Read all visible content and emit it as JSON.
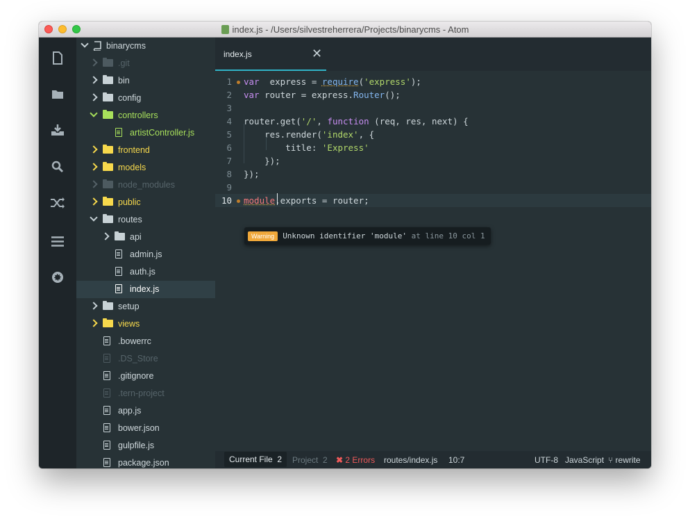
{
  "window": {
    "title": "index.js - /Users/silvestreherrera/Projects/binarycms - Atom"
  },
  "sidebar_icons": [
    "file-icon",
    "folder-icon",
    "download-icon",
    "search-icon",
    "shuffle-icon",
    "menu-icon",
    "gear-icon"
  ],
  "tree": {
    "root": "binarycms",
    "items": [
      {
        "label": ".git",
        "type": "folder",
        "depth": 1,
        "state": "collapsed",
        "style": "dim"
      },
      {
        "label": "bin",
        "type": "folder",
        "depth": 1,
        "state": "collapsed",
        "style": "normal"
      },
      {
        "label": "config",
        "type": "folder",
        "depth": 1,
        "state": "collapsed",
        "style": "normal"
      },
      {
        "label": "controllers",
        "type": "folder",
        "depth": 1,
        "state": "expanded",
        "style": "green"
      },
      {
        "label": "artistController.js",
        "type": "file",
        "depth": 2,
        "style": "green"
      },
      {
        "label": "frontend",
        "type": "folder",
        "depth": 1,
        "state": "collapsed",
        "style": "yellow"
      },
      {
        "label": "models",
        "type": "folder",
        "depth": 1,
        "state": "collapsed",
        "style": "yellow"
      },
      {
        "label": "node_modules",
        "type": "folder",
        "depth": 1,
        "state": "collapsed",
        "style": "dim"
      },
      {
        "label": "public",
        "type": "folder",
        "depth": 1,
        "state": "collapsed",
        "style": "yellow"
      },
      {
        "label": "routes",
        "type": "folder",
        "depth": 1,
        "state": "expanded",
        "style": "normal"
      },
      {
        "label": "api",
        "type": "folder",
        "depth": 2,
        "state": "collapsed",
        "style": "normal"
      },
      {
        "label": "admin.js",
        "type": "file",
        "depth": 2,
        "style": "normal"
      },
      {
        "label": "auth.js",
        "type": "file",
        "depth": 2,
        "style": "normal"
      },
      {
        "label": "index.js",
        "type": "file",
        "depth": 2,
        "style": "selected"
      },
      {
        "label": "setup",
        "type": "folder",
        "depth": 1,
        "state": "collapsed",
        "style": "normal"
      },
      {
        "label": "views",
        "type": "folder",
        "depth": 1,
        "state": "collapsed",
        "style": "yellow"
      },
      {
        "label": ".bowerrc",
        "type": "file",
        "depth": 1,
        "style": "normal"
      },
      {
        "label": ".DS_Store",
        "type": "file",
        "depth": 1,
        "style": "dim"
      },
      {
        "label": ".gitignore",
        "type": "file",
        "depth": 1,
        "style": "normal"
      },
      {
        "label": ".tern-project",
        "type": "file",
        "depth": 1,
        "style": "dim"
      },
      {
        "label": "app.js",
        "type": "file",
        "depth": 1,
        "style": "normal"
      },
      {
        "label": "bower.json",
        "type": "file",
        "depth": 1,
        "style": "normal"
      },
      {
        "label": "gulpfile.js",
        "type": "file",
        "depth": 1,
        "style": "normal"
      },
      {
        "label": "package.json",
        "type": "file",
        "depth": 1,
        "style": "normal"
      }
    ]
  },
  "tab": {
    "label": "index.js",
    "close": "✕"
  },
  "editor": {
    "lines": [
      {
        "n": "1",
        "tokens": [
          [
            "kw",
            "var"
          ],
          [
            "",
            "  express = "
          ],
          [
            "fn warnline",
            "require"
          ],
          [
            "",
            "("
          ],
          [
            "str",
            "'express'"
          ],
          [
            "",
            ");"
          ]
        ],
        "marker": true
      },
      {
        "n": "2",
        "tokens": [
          [
            "kw",
            "var"
          ],
          [
            "",
            " router = express."
          ],
          [
            "fn",
            "Router"
          ],
          [
            "",
            "();"
          ]
        ]
      },
      {
        "n": "3",
        "tokens": []
      },
      {
        "n": "4",
        "tokens": [
          [
            "",
            "router.get("
          ],
          [
            "str",
            "'/'"
          ],
          [
            "",
            ", "
          ],
          [
            "kw",
            "function"
          ],
          [
            "",
            " (req, res, next) {"
          ]
        ]
      },
      {
        "n": "5",
        "tokens": [
          [
            "",
            "    res.render("
          ],
          [
            "str",
            "'index'"
          ],
          [
            "",
            ", {"
          ]
        ]
      },
      {
        "n": "6",
        "tokens": [
          [
            "",
            "        title: "
          ],
          [
            "str",
            "'Express'"
          ]
        ]
      },
      {
        "n": "7",
        "tokens": [
          [
            "",
            "    });"
          ]
        ]
      },
      {
        "n": "8",
        "tokens": [
          [
            "",
            "});"
          ]
        ]
      },
      {
        "n": "9",
        "tokens": []
      },
      {
        "n": "10",
        "tokens": [
          [
            "mod warnline",
            "module"
          ],
          [
            "",
            ".exports = router;"
          ]
        ],
        "marker": true,
        "current": true
      }
    ],
    "tooltip": {
      "badge": "Warning",
      "message": "Unknown identifier 'module'",
      "location": "at line 10 col 1"
    }
  },
  "status": {
    "current_file": "Current File",
    "current_file_count": "2",
    "project": "Project",
    "project_count": "2",
    "errors": "2 Errors",
    "path": "routes/index.js",
    "cursor": "10:7",
    "encoding": "UTF-8",
    "grammar": "JavaScript",
    "branch": "rewrite"
  },
  "colors": {
    "accent": "#31b4c8",
    "warning": "#f0a83a",
    "error": "#f05a5a",
    "green": "#a8e05b",
    "yellow": "#f7d94c"
  }
}
